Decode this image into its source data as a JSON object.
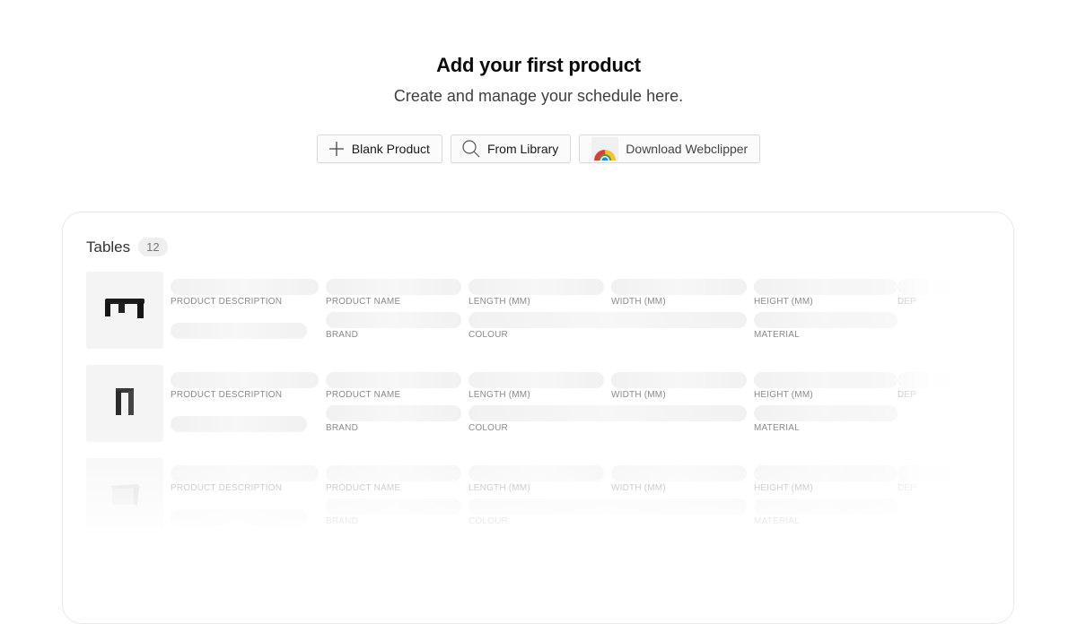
{
  "hero": {
    "title": "Add your first product",
    "subtitle": "Create and manage your schedule here."
  },
  "actions": {
    "blank_product": "Blank Product",
    "from_library": "From Library",
    "download_webclipper": "Download Webclipper"
  },
  "preview": {
    "title": "Tables",
    "count": "12",
    "fields": {
      "product_description": "PRODUCT DESCRIPTION",
      "product_name": "PRODUCT NAME",
      "length": "LENGTH (MM)",
      "width": "WIDTH (MM)",
      "height": "HEIGHT (MM)",
      "depth_truncated": "DEP",
      "brand": "BRAND",
      "colour": "COLOUR",
      "material": "MATERIAL"
    },
    "rows": [
      {
        "thumbnail_icon": "dark-coffee-table-icon"
      },
      {
        "thumbnail_icon": "dark-side-table-icon"
      },
      {
        "thumbnail_icon": "white-desk-icon"
      }
    ]
  },
  "colors": {
    "border": "#d9d9d9",
    "skeleton": "#f1f1f1",
    "label": "#8a8a8a"
  }
}
